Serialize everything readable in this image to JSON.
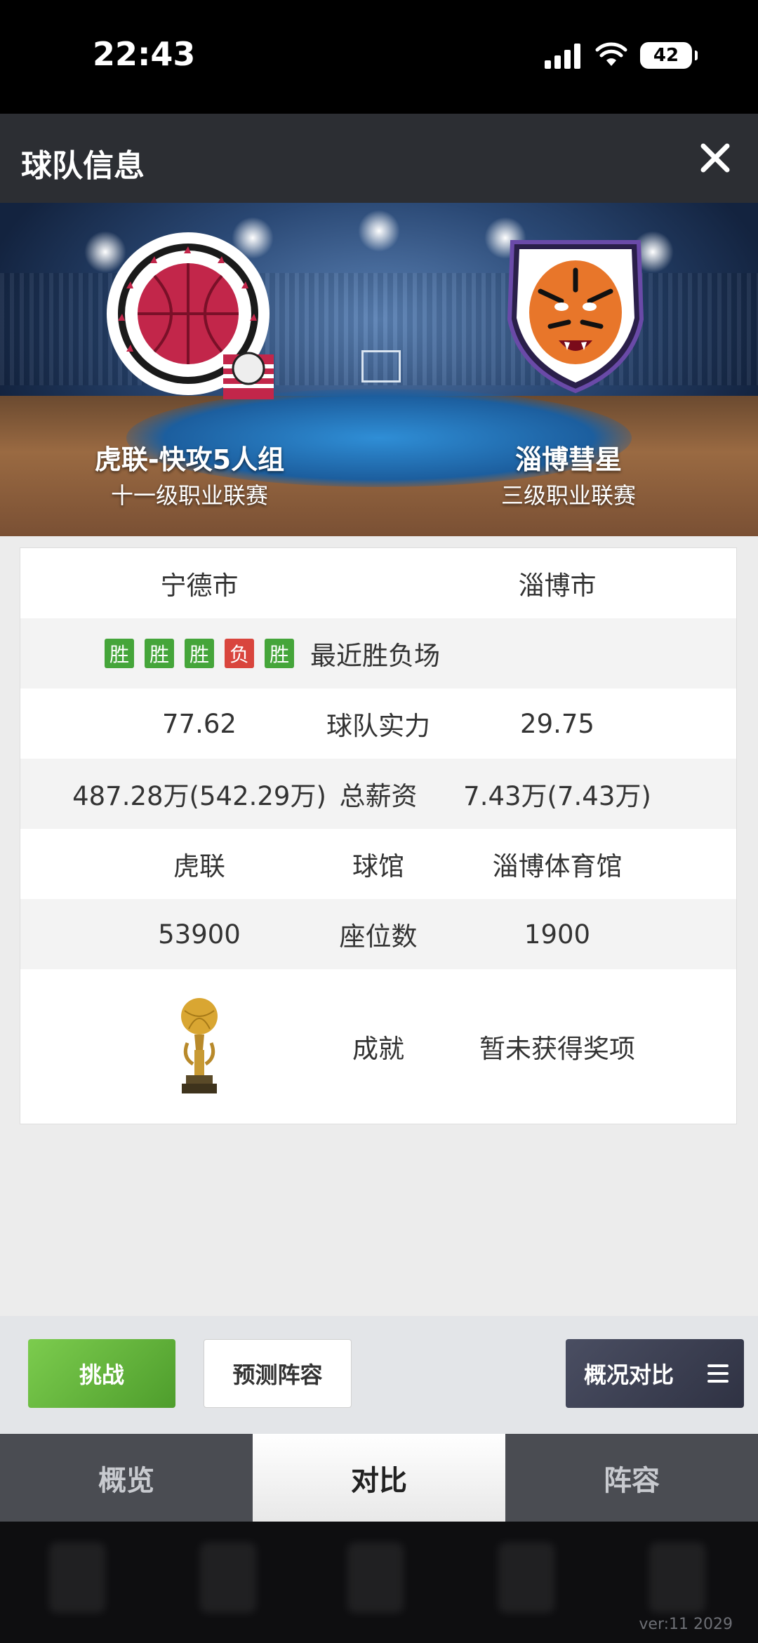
{
  "status_bar": {
    "time": "22:43",
    "battery": "42"
  },
  "header": {
    "title": "球队信息"
  },
  "teams": {
    "left": {
      "name": "虎联-快攻5人组",
      "league": "十一级职业联赛"
    },
    "right": {
      "name": "淄博彗星",
      "league": "三级职业联赛"
    }
  },
  "comparison": {
    "cities": {
      "left": "宁德市",
      "right": "淄博市"
    },
    "recent": {
      "label": "最近胜负场",
      "results": [
        "胜",
        "胜",
        "胜",
        "负",
        "胜"
      ]
    },
    "strength": {
      "label": "球队实力",
      "left": "77.62",
      "right": "29.75"
    },
    "salary": {
      "label": "总薪资",
      "left": "487.28万(542.29万)",
      "right": "7.43万(7.43万)"
    },
    "arena": {
      "label": "球馆",
      "left": "虎联",
      "right": "淄博体育馆"
    },
    "seats": {
      "label": "座位数",
      "left": "53900",
      "right": "1900"
    },
    "achievement": {
      "label": "成就",
      "right": "暂未获得奖项"
    }
  },
  "actions": {
    "challenge": "挑战",
    "predict": "预测阵容",
    "compare": "概况对比"
  },
  "tabs": [
    {
      "label": "概览",
      "active": false
    },
    {
      "label": "对比",
      "active": true
    },
    {
      "label": "阵容",
      "active": false
    }
  ],
  "version": "ver:11  2029",
  "colors": {
    "win": "#45a53a",
    "loss": "#d9453d",
    "challenge": "#5fb33a",
    "header": "#2c2e33"
  }
}
